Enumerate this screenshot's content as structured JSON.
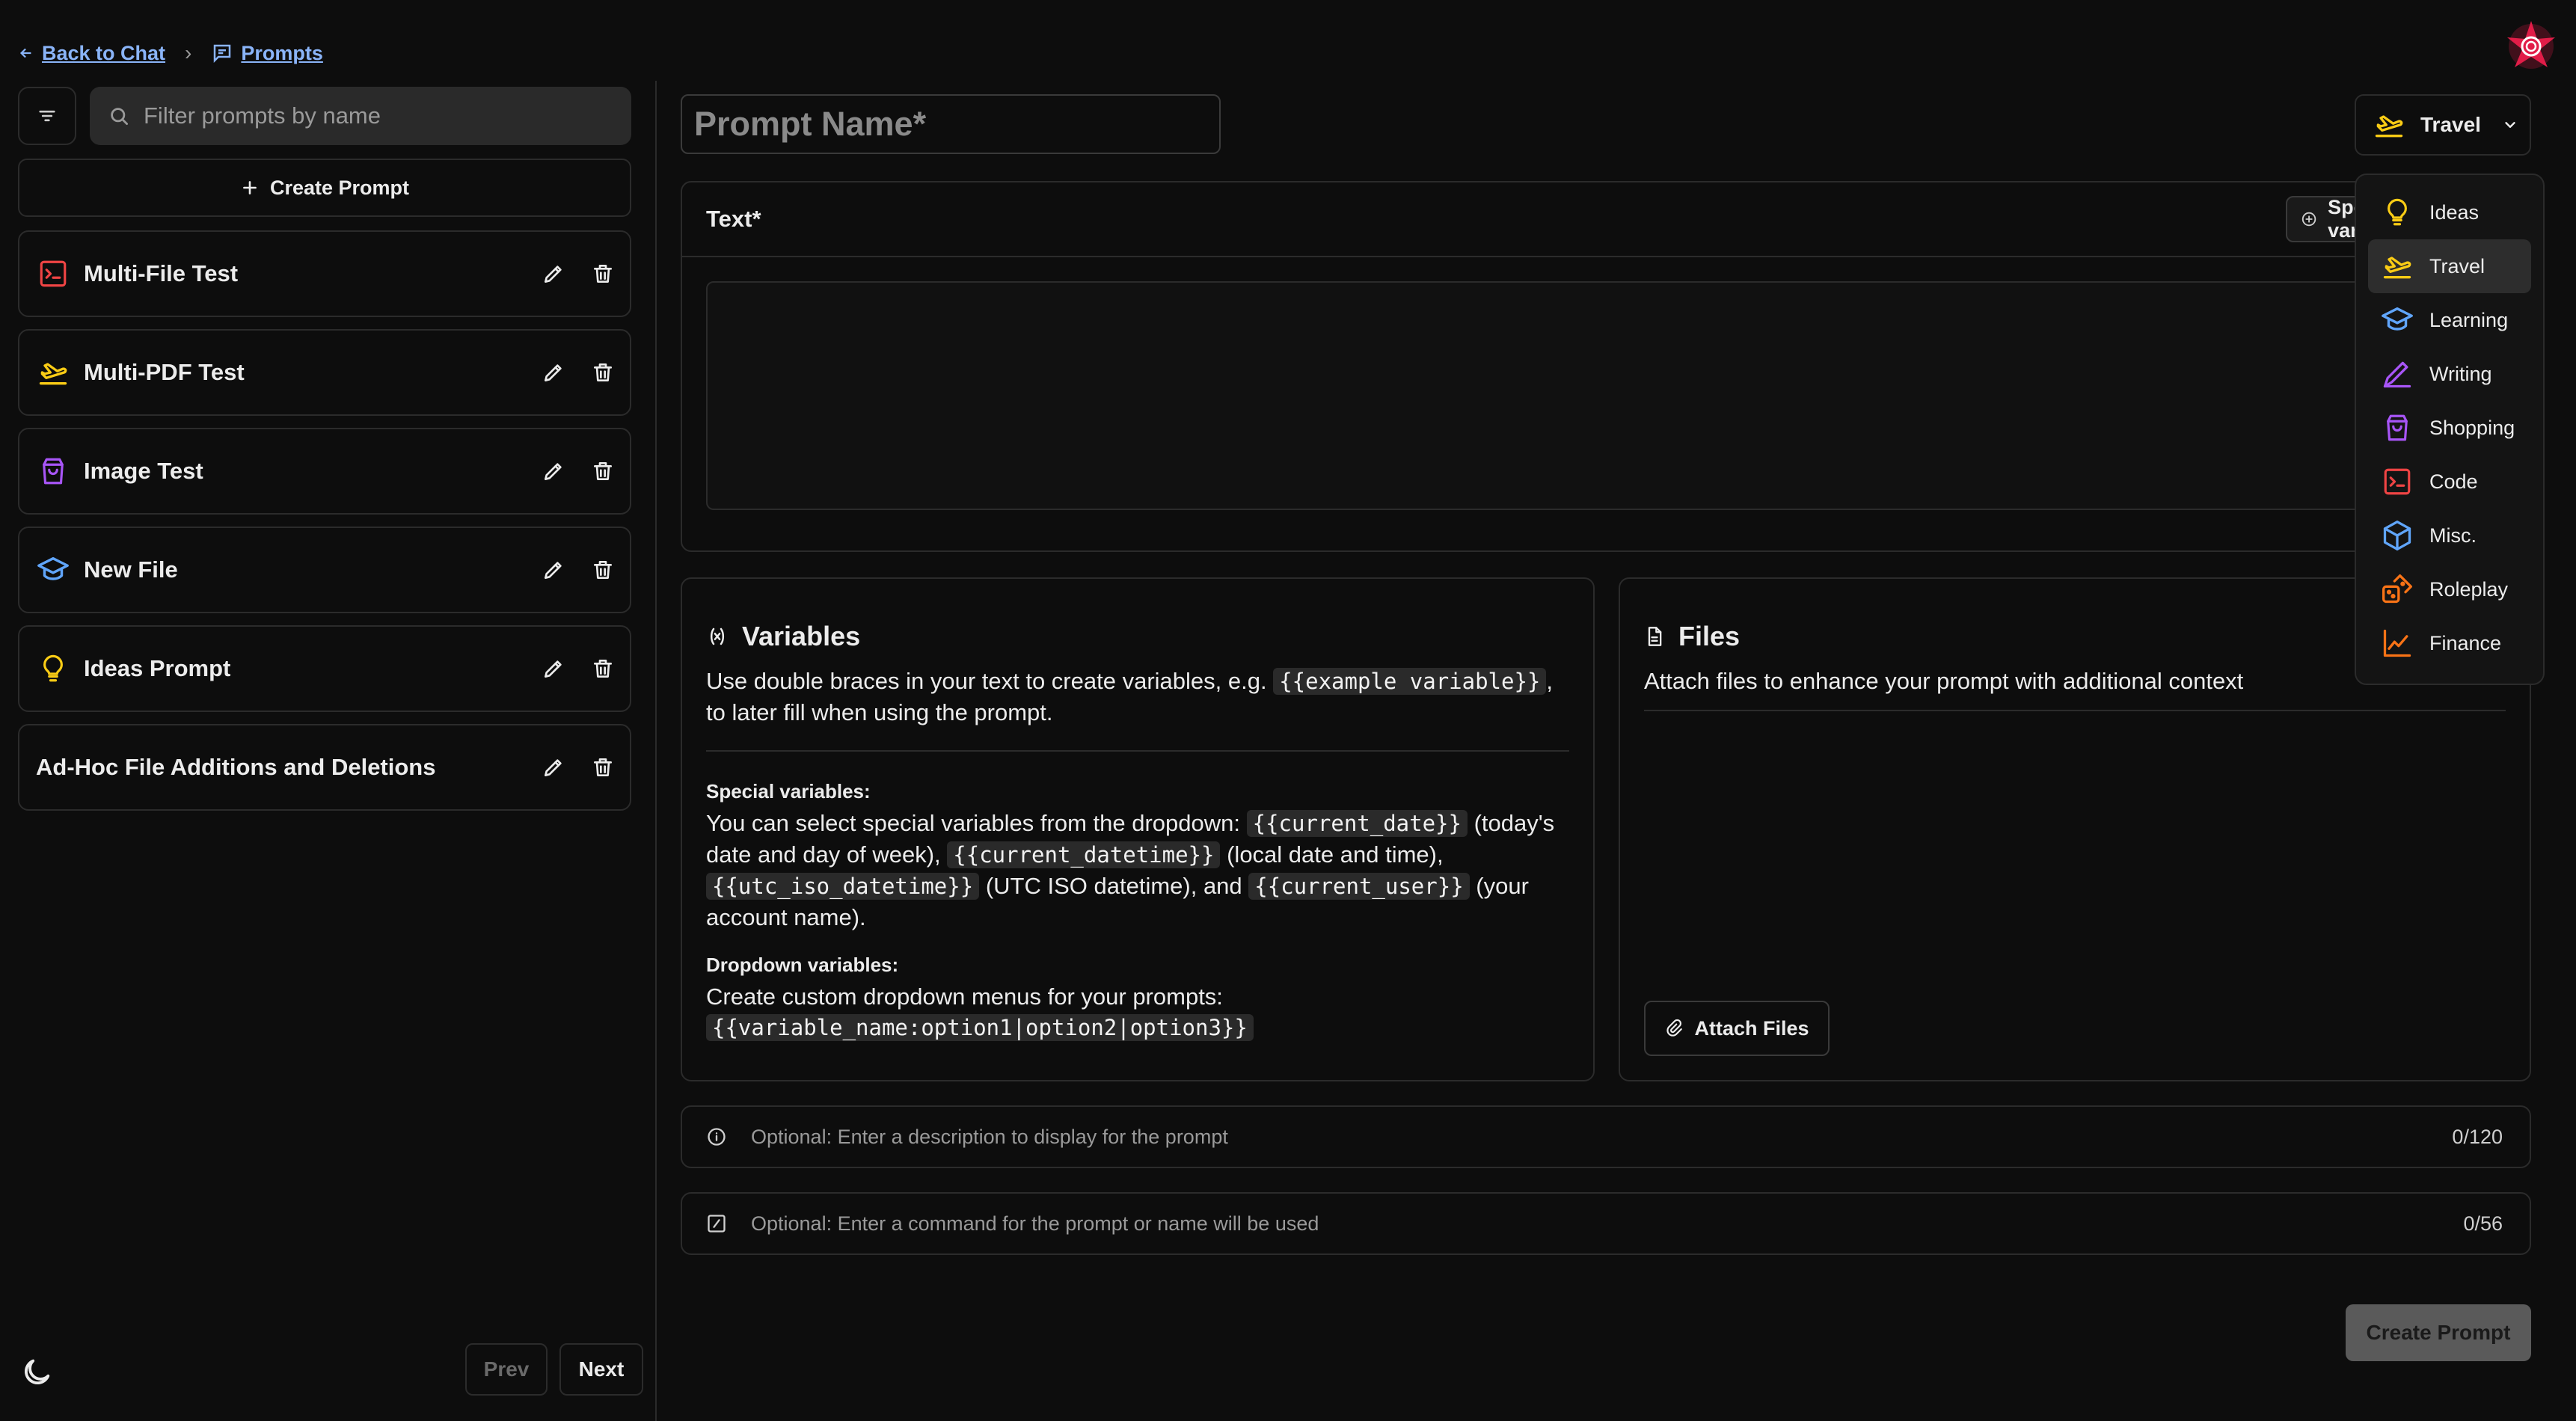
{
  "nav": {
    "back_label": "Back to Chat",
    "separator": "›",
    "prompts_label": "Prompts"
  },
  "sidebar": {
    "search_placeholder": "Filter prompts by name",
    "create_label": "Create Prompt",
    "items": [
      {
        "name": "Multi-File Test",
        "icon": "terminal-icon",
        "color": "#ef4444"
      },
      {
        "name": "Multi-PDF Test",
        "icon": "plane-icon",
        "color": "#facc15"
      },
      {
        "name": "Image Test",
        "icon": "shopping-bag-icon",
        "color": "#a855f7"
      },
      {
        "name": "New File",
        "icon": "graduation-cap-icon",
        "color": "#60a5fa"
      },
      {
        "name": "Ideas Prompt",
        "icon": "lightbulb-icon",
        "color": "#facc15"
      },
      {
        "name": "Ad-Hoc File Additions and Deletions",
        "icon": "",
        "color": ""
      }
    ],
    "pager": {
      "prev": "Prev",
      "next": "Next"
    }
  },
  "editor": {
    "name_placeholder": "Prompt Name*",
    "category_selected": "Travel",
    "text_label": "Text*",
    "special_label": "Special variables",
    "variables": {
      "title": "Variables",
      "intro_1": "Use double braces in your text to create variables, e.g.",
      "intro_token": "{{example variable}}",
      "intro_2": ", to later fill when using the prompt.",
      "special_heading": "Special variables:",
      "special_1": "You can select special variables from the dropdown:",
      "tok_current_date": "{{current_date}}",
      "special_2": "(today's date and day of week),",
      "tok_current_datetime": "{{current_datetime}}",
      "special_3": "(local date and time),",
      "tok_utc": "{{utc_iso_datetime}}",
      "special_4": "(UTC ISO datetime), and",
      "tok_user": "{{current_user}}",
      "special_5": "(your account name).",
      "dropdown_heading": "Dropdown variables:",
      "dropdown_text": "Create custom dropdown menus for your prompts:",
      "tok_dropdown": "{{variable_name:option1|option2|option3}}"
    },
    "files": {
      "title": "Files",
      "description": "Attach files to enhance your prompt with additional context",
      "attach_label": "Attach Files"
    },
    "description_field": {
      "placeholder": "Optional: Enter a description to display for the prompt",
      "count": "0/120"
    },
    "command_field": {
      "placeholder": "Optional: Enter a command for the prompt or name will be used",
      "count": "0/56"
    },
    "create_label": "Create Prompt"
  },
  "category_menu": {
    "items": [
      {
        "label": "Ideas",
        "icon": "lightbulb-icon",
        "color": "#facc15"
      },
      {
        "label": "Travel",
        "icon": "plane-icon",
        "color": "#facc15"
      },
      {
        "label": "Learning",
        "icon": "graduation-cap-icon",
        "color": "#60a5fa"
      },
      {
        "label": "Writing",
        "icon": "pen-icon",
        "color": "#a855f7"
      },
      {
        "label": "Shopping",
        "icon": "shopping-bag-icon",
        "color": "#a855f7"
      },
      {
        "label": "Code",
        "icon": "terminal-icon",
        "color": "#ef4444"
      },
      {
        "label": "Misc.",
        "icon": "cube-icon",
        "color": "#60a5fa"
      },
      {
        "label": "Roleplay",
        "icon": "dice-icon",
        "color": "#f97316"
      },
      {
        "label": "Finance",
        "icon": "line-chart-icon",
        "color": "#f97316"
      }
    ]
  }
}
